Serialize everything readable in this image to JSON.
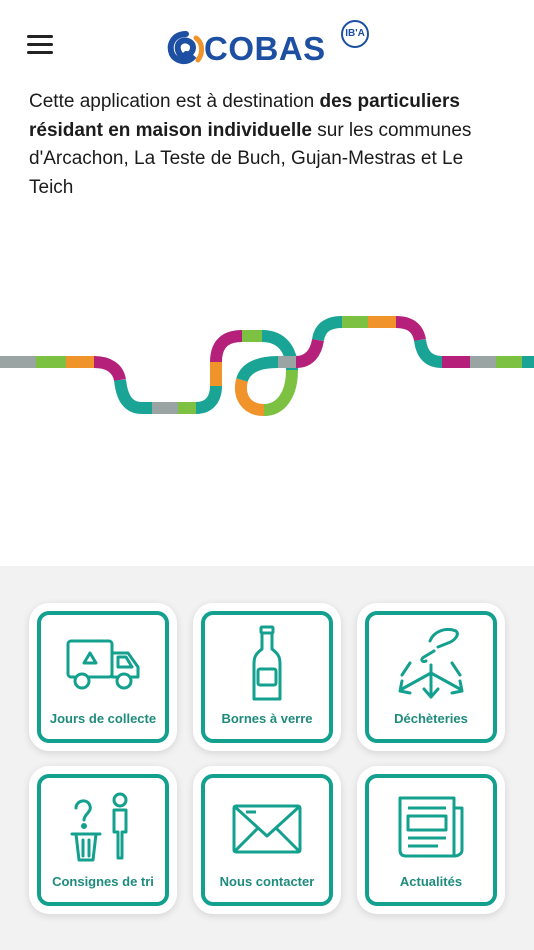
{
  "header": {
    "menu_icon": "hamburger-menu-icon",
    "logo_text": "COBAS",
    "logo_badge": "IB'A"
  },
  "intro": {
    "part1": "Cette application est à destination ",
    "bold": "des particuliers résidant en maison individuelle",
    "part2": " sur les communes d'Arcachon, La Teste de Buch, Gujan-Mestras et Le Teich"
  },
  "colors": {
    "accent": "#13a08e",
    "brand_blue": "#1d4fa3",
    "wave_teal": "#1aa495",
    "wave_magenta": "#b5217a",
    "wave_orange": "#f0932a",
    "wave_green": "#7dc143",
    "wave_grey": "#9aa4a2",
    "panel_bg": "#f2f2f2"
  },
  "tiles": [
    {
      "label": "Jours de collecte",
      "icon": "collection-truck-icon"
    },
    {
      "label": "Bornes à verre",
      "icon": "glass-bottle-icon"
    },
    {
      "label": "Déchèteries",
      "icon": "recycling-center-icon"
    },
    {
      "label": "Consignes de tri",
      "icon": "sorting-instructions-icon"
    },
    {
      "label": "Nous contacter",
      "icon": "envelope-icon"
    },
    {
      "label": "Actualités",
      "icon": "newspaper-icon"
    }
  ]
}
